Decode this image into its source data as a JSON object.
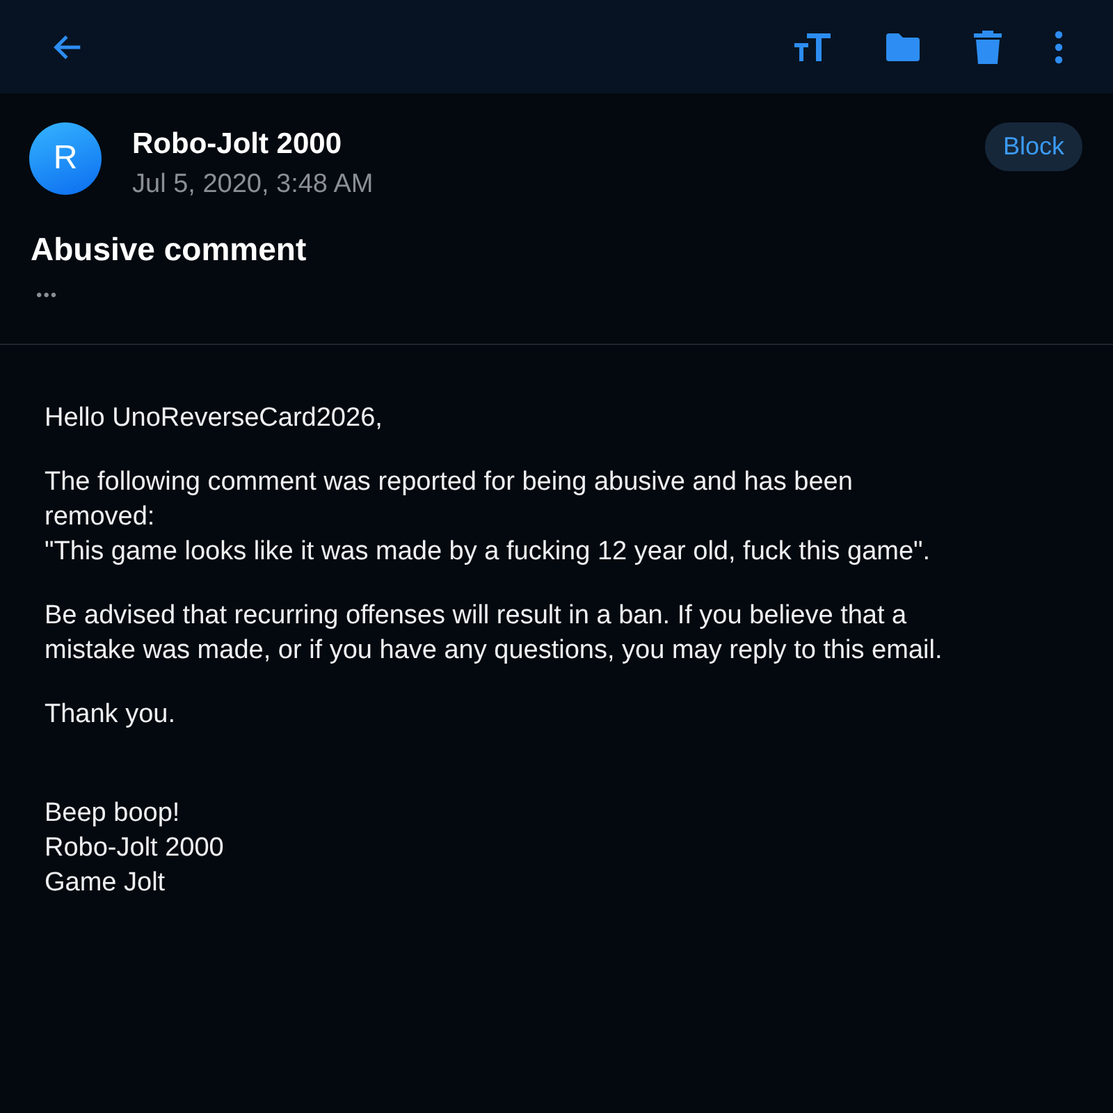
{
  "toolbar": {
    "actions": [
      {
        "kind": "text-size"
      },
      {
        "kind": "folder"
      },
      {
        "kind": "delete"
      },
      {
        "kind": "more"
      }
    ]
  },
  "message": {
    "avatar": "R",
    "sender": "Robo-Jolt 2000",
    "date": "Jul 5, 2020, 3:48 AM",
    "block_button": "Block",
    "subject": "Abusive comment",
    "more": "•••",
    "paragraphs": [
      {
        "lines": [
          "Hello UnoReverseCard2026,"
        ]
      },
      {
        "lines": [
          "The following comment was reported for being abusive and has been",
          "removed:",
          "\"This game looks like it was made by a fucking 12 year old, fuck this game\"."
        ]
      },
      {
        "lines": [
          "Be advised that recurring offenses will result in a ban. If you believe that a",
          "mistake was made, or if you have any questions, you may reply to this email."
        ]
      },
      {
        "lines": [
          "Thank you."
        ]
      },
      {
        "kind": "signature",
        "lines": [
          "Beep boop!",
          "Robo-Jolt 2000",
          "Game Jolt"
        ]
      }
    ]
  }
}
